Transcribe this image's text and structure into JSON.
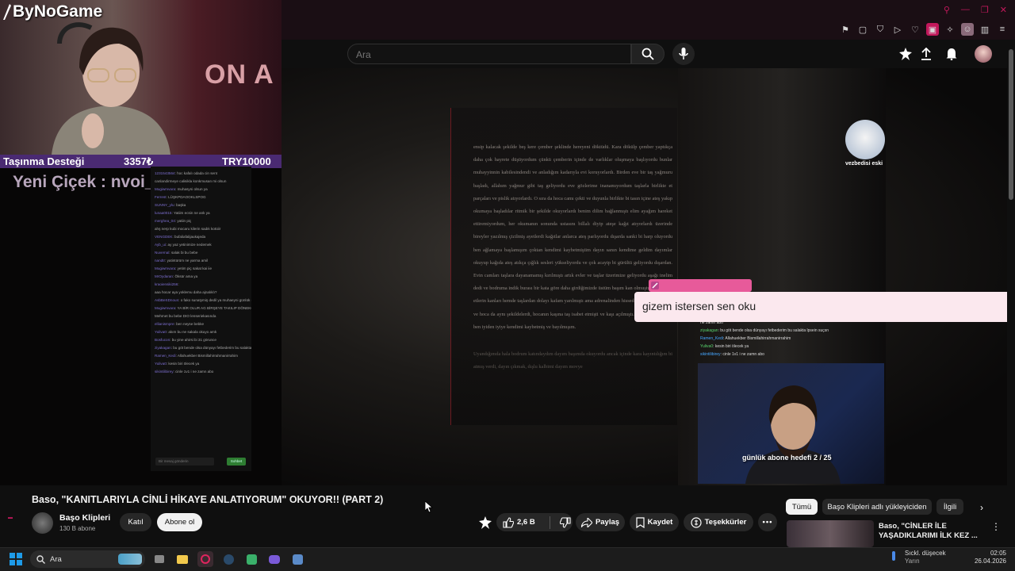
{
  "stream": {
    "logo": "ByNoGame",
    "donation_label": "Taşınma Desteği",
    "donation_amount": "3357₺",
    "donation_goal": "TRY10000",
    "new_follower": "Yeni Çiçek : nvoi_mitsbrex",
    "overlay_sign": "ON A",
    "notification_message": "gizem istersen sen oku",
    "sub_goal": "günlük abone hedefi 2 / 25",
    "cat_label": "vezbedisi eski"
  },
  "story_text": "ensip kalacak şekilde beş kere çember şeklinde hereyeni döktüdü. Kara dökülp çember yaptıkça daha çok hayrete düşüyordum çünkü çemberin içinde de varlıklar oluşmaya başlıyordu bunlar muhayyinnin kabilesindendi ve anladığım kadarıyla evi koruyorlardı. Birden eve bir taş yağmuru başladı, allahım yağmur gibi taş geliyordu eve gözlerime inanamıyordum taşlarla birlikte et parçaları ve pislik atıyorlardı. O sıra da hoca camı çekti ve duyunla birlikte bi tasın içine ateş yakıp okumaya başladılar ritmik bir şekilde okuyorlardı benim dilim bağlanmıştı elim ayağım hareket ettiremiyordum, her okumanın sonunda ustasını billalı diyip ateşe kağıt atıyorlardı üzerinde bireyler yazılmış çizilmiş ayetlerdi kağıtlar anlarca ateş parlıyordu dışarda sanki bi harp oluyordu ben ağlamaya başlamışım çoktan kendimi kaybetmiştim dayın sanın kendime geldim dayımlar okuyup kağıda ateş atıkça çığlık sesleri yükseliyordu ve çok acayip bi gürültü geliyordu dışardan. Evin camları taşlara dayanamamış kırılmıştı artık evler ve taşlar üzerimize geliyordu aşağı inelim dedi ve bodruma indik burası bir kata göre daha girdiğimizde üstüm başım kan olmuştu hem atılan etlerin kanları hemde taşlardan dolayı kafam yarılmıştı ama adrenalinden hissedememiştim. Dayım ve hoca da aynı şekildelerdi, hocanın kaşına taş isabet etmişti ve kaşı açılmıştı. Bunlar yaşanırken ben iyiden iyiye kendimi kaybetmiş ve bayılmışım.",
  "story_text_2": "Uyandığımda hala bodrum katındaydım dayım başımda okuyordu ancak içinde kara kayıntılığım bi atmış verdi, dayın çıkmak, dışlu kalbimi dayım movye",
  "chat_left": [
    {
      "user": "1231543564",
      "text": "hoc kafalı odada cin sent"
    },
    {
      "user": "",
      "text": "canlandirmeye calisikla konkmusan mi olsun"
    },
    {
      "user": "Mugiwmvara",
      "text": "muhasyni olsun ya"
    },
    {
      "user": "Ferrest",
      "text": "LÜŞKPDAOOKLSPOG"
    },
    {
      "user": "SUNNY_ylu",
      "text": "başka"
    },
    {
      "user": "lunaa0015",
      "text": "Yatiim ecsin ne ank ya"
    },
    {
      "user": "merghea_04",
      "text": "yatiin piç"
    },
    {
      "user": "",
      "text": "ahş nerp kubi mocaru kilerin sadık kotüiir"
    },
    {
      "user": "VENGDEK",
      "text": "bufaliafalijaukajeda"
    },
    {
      "user": "Ayb_ui",
      "text": "ay yaz yetinimize nedemek"
    },
    {
      "user": "Nuvernal",
      "text": "salak bi bu bebe"
    },
    {
      "user": "nandtr",
      "text": "yatintürüm ne yarma amil"
    },
    {
      "user": "Mugiwmvara",
      "text": "yetim piç sakat kai iie"
    },
    {
      "user": "MrOydaran",
      "text": "Öksür ama ya"
    },
    {
      "user": "kraoiensiki256",
      "text": ""
    },
    {
      "user": "",
      "text": "aaa hocar aya yoklemu daha ajnalıklı?"
    },
    {
      "user": "AsbBeSDnoun",
      "text": "o fako sunatymiş dedil ya muhaeyni günlük seviii daha farklı ama imfauranu vermedi"
    },
    {
      "user": "Mugiwmvara",
      "text": "YA BİR OLUR AG BİRŞEYE TAKILIP DÖNEKO YYAŞI GİB"
    },
    {
      "user": "",
      "text": "Mehmet bu bebe DIO lenseriekasında"
    },
    {
      "user": "ellianismpre",
      "text": "ben neyse bebke"
    },
    {
      "user": "Yuliva0",
      "text": "akım bu ne sakala okuyo amk"
    },
    {
      "user": "Bosfucon",
      "text": "bu yine ahirsi bi 31 görunce"
    },
    {
      "user": "ziyakagan",
      "text": "bu göt bende olsa dünyayı fetbederim bu salakta lpsein suçsn"
    },
    {
      "user": "Ramen_Kedi",
      "text": "Allahuekber Bismillahirrahmanirrahim"
    },
    {
      "user": "Yuliva0",
      "text": "kesin biri ölecek ya"
    },
    {
      "user": "sikintilibirey",
      "text": "cinle 1v1 i ne zamn abo"
    }
  ],
  "chat_right": [
    {
      "user": "",
      "text": "ne zamn abo"
    },
    {
      "user": "ziyakagan",
      "text": "bu göt bende olsa dünyayı fetbederim bu salakta lpsein suçsn"
    },
    {
      "user": "Ramen_Kedi",
      "text": "Allahuekber Bismillahirrahmanirrahim"
    },
    {
      "user": "Yuliva0",
      "text": "kesin biri ölecek ya"
    },
    {
      "user": "sikintilibirey",
      "text": "cinle 1v1 i ne zamn abo"
    }
  ],
  "chat_input_placeholder": "Bir mesaj gönderin",
  "chat_send": "Sohbet",
  "header": {
    "search_placeholder": "Ara"
  },
  "video": {
    "title": "Baso, \"KANITLARIYLA CİNLİ HİKAYE ANLATIYORUM\" OKUYOR!! (PART 2)",
    "channel": "Başo Klipleri",
    "subscribers": "130 B abone",
    "join": "Katıl",
    "subscribe": "Abone ol",
    "likes": "2,6 B",
    "share": "Paylaş",
    "save": "Kaydet",
    "thanks": "Teşekkürler"
  },
  "chips": [
    "Tümü",
    "Başo Klipleri adlı yükleyiciden",
    "İlgili"
  ],
  "related": {
    "title": "Baso, \"CİNLER İLE YAŞADIKLARIMI İLK KEZ ..."
  },
  "taskbar": {
    "search": "Ara",
    "weather_title": "Sıckl. düşecek",
    "weather_sub": "Yarın",
    "time": "02:05",
    "date": "26.04.2026"
  },
  "colors": {
    "accent": "#c2185b",
    "donation_bar": "#4a2a72",
    "notification_bg": "#fbe8ee",
    "notification_user": "#e75a9a"
  }
}
